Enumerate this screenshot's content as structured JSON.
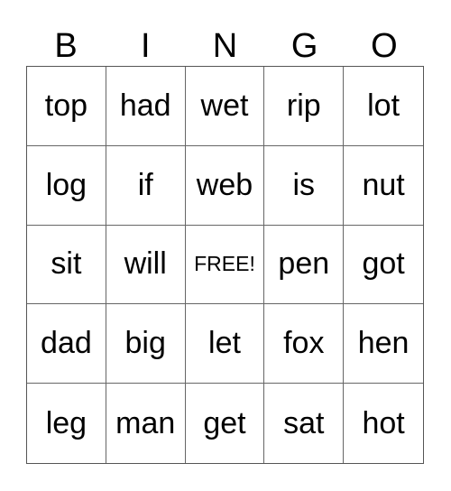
{
  "card": {
    "header": [
      "B",
      "I",
      "N",
      "G",
      "O"
    ],
    "rows": [
      [
        "top",
        "had",
        "wet",
        "rip",
        "lot"
      ],
      [
        "log",
        "if",
        "web",
        "is",
        "nut"
      ],
      [
        "sit",
        "will",
        "FREE!",
        "pen",
        "got"
      ],
      [
        "dad",
        "big",
        "let",
        "fox",
        "hen"
      ],
      [
        "leg",
        "man",
        "get",
        "sat",
        "hot"
      ]
    ],
    "free_space_label": "FREE!"
  }
}
